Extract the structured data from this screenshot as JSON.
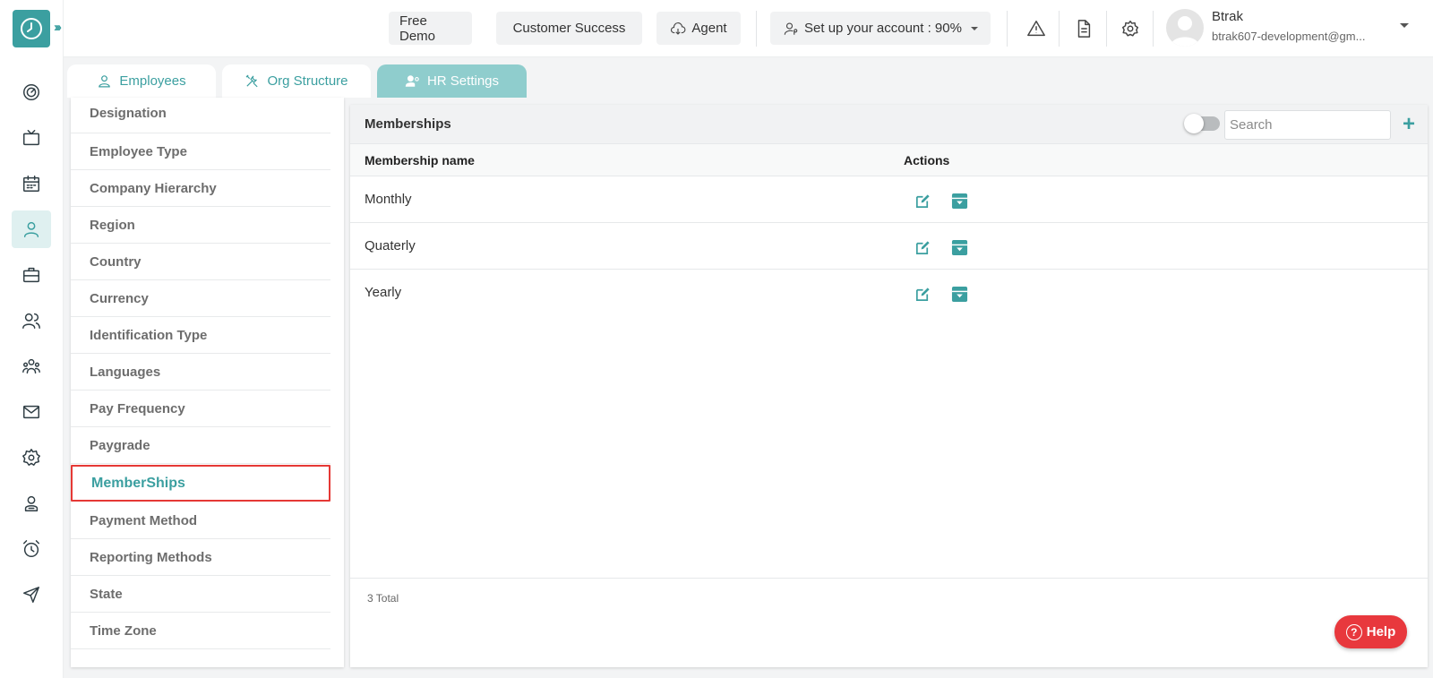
{
  "app": {
    "logo_icon": "clock-icon",
    "accent": "#3b9fa0",
    "highlight": "#e53935"
  },
  "rail": {
    "items": [
      {
        "name": "dashboard-icon"
      },
      {
        "name": "tv-icon"
      },
      {
        "name": "calendar-icon"
      },
      {
        "name": "user-icon",
        "active": true
      },
      {
        "name": "briefcase-icon"
      },
      {
        "name": "users-icon"
      },
      {
        "name": "team-icon"
      },
      {
        "name": "mail-icon"
      },
      {
        "name": "gear-icon"
      },
      {
        "name": "profile-icon"
      },
      {
        "name": "alarm-icon"
      },
      {
        "name": "send-icon"
      }
    ]
  },
  "topbar": {
    "free_demo": "Free Demo",
    "customer_success": "Customer Success",
    "agent": "Agent",
    "setup_account": "Set up your account : 90%",
    "user_name": "Btrak",
    "user_email": "btrak607-development@gm..."
  },
  "tabs": [
    {
      "label": "Employees",
      "icon": "user-icon"
    },
    {
      "label": "Org Structure",
      "icon": "tools-icon"
    },
    {
      "label": "HR Settings",
      "icon": "user-gear-icon",
      "active": true
    }
  ],
  "settings_menu": {
    "items": [
      "Designation",
      "Employee Type",
      "Company Hierarchy",
      "Region",
      "Country",
      "Currency",
      "Identification Type",
      "Languages",
      "Pay Frequency",
      "Paygrade",
      "MemberShips",
      "Payment Method",
      "Reporting Methods",
      "State",
      "Time Zone"
    ],
    "selected": "MemberShips"
  },
  "memberships": {
    "title": "Memberships",
    "search_placeholder": "Search",
    "columns": {
      "name": "Membership name",
      "actions": "Actions"
    },
    "rows": [
      {
        "name": "Monthly"
      },
      {
        "name": "Quaterly"
      },
      {
        "name": "Yearly"
      }
    ],
    "total": "3 Total",
    "add_label": "+"
  },
  "help": {
    "label": "Help",
    "q": "?"
  }
}
